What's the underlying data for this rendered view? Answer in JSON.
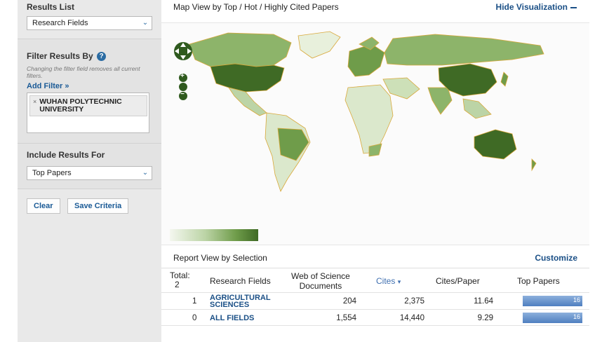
{
  "sidebar": {
    "results_list_title": "Results List",
    "results_list_value": "Research Fields",
    "filter_title": "Filter Results By",
    "help_glyph": "?",
    "filter_hint": "Changing the filter field removes all current filters.",
    "add_filter": "Add Filter »",
    "filter_chip": "WUHAN POLYTECHNIC UNIVERSITY",
    "chip_remove": "×",
    "include_title": "Include Results For",
    "include_value": "Top Papers",
    "dropdown_glyph": "⌄",
    "clear_label": "Clear",
    "save_label": "Save Criteria"
  },
  "map": {
    "title": "Map View by Top / Hot / Highly Cited Papers",
    "hide_label": "Hide Visualization",
    "zoom_in": "+",
    "zoom_out": "−"
  },
  "report": {
    "title": "Report View by Selection",
    "customize_label": "Customize",
    "headers": {
      "total": "Total:",
      "total_count": "2",
      "field": "Research Fields",
      "wos_line1": "Web of Science",
      "wos_line2": "Documents",
      "cites": "Cites",
      "cites_sort_glyph": "▾",
      "cites_per_paper": "Cites/Paper",
      "top_papers": "Top Papers"
    },
    "rows": [
      {
        "rank": "1",
        "field_line1": "AGRICULTURAL",
        "field_line2": "SCIENCES",
        "wos": "204",
        "cites": "2,375",
        "cites_per_paper": "11.64",
        "top_papers": "16",
        "bar_fraction": 1.0
      },
      {
        "rank": "0",
        "field_line1": "ALL FIELDS",
        "field_line2": "",
        "wos": "1,554",
        "cites": "14,440",
        "cites_per_paper": "9.29",
        "top_papers": "16",
        "bar_fraction": 1.0
      }
    ]
  },
  "colors": {
    "link": "#1a4f86",
    "map_dark": "#3f6a25",
    "map_mid": "#6f9c4a",
    "map_light": "#cde0b8",
    "bar": "#4f7fc0"
  }
}
